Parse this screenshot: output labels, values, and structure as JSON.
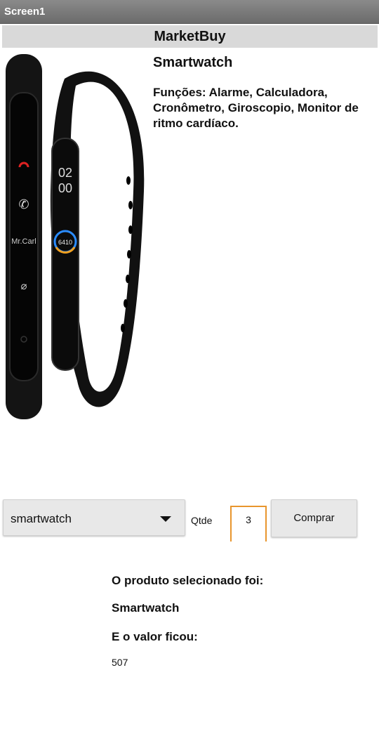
{
  "window": {
    "title": "Screen1"
  },
  "header": {
    "title": "MarketBuy"
  },
  "product": {
    "image_icon": "smartwatch-band-image",
    "title": "Smartwatch",
    "description": "Funções: Alarme, Calculadora, Cronômetro, Giroscopio, Monitor de ritmo cardíaco.",
    "watch_left_text": "Mr.Carl",
    "watch_right_time_h": "02",
    "watch_right_time_m": "00",
    "watch_right_steps": "6410"
  },
  "order": {
    "selected_product": "smartwatch",
    "quantity_label": "Qtde",
    "quantity_value": "3",
    "buy_label": "Comprar"
  },
  "result": {
    "selected_label": "O produto selecionado foi:",
    "selected_product": "Smartwatch",
    "value_label": "E o valor ficou:",
    "value": "507"
  },
  "colors": {
    "accent": "#e8952d",
    "header_bg": "#d9d9d9",
    "titlebar": "#7a7a7a"
  }
}
